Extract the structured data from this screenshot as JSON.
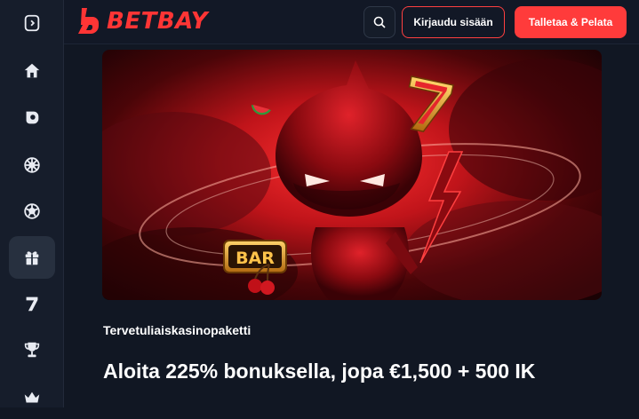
{
  "header": {
    "brand": "BETBAY",
    "login_label": "Kirjaudu sisään",
    "deposit_label": "Talletaa & Pelata"
  },
  "sidebar": {
    "items": [
      {
        "icon": "collapse-sidebar-icon"
      },
      {
        "icon": "home-icon"
      },
      {
        "icon": "poker-chip-icon"
      },
      {
        "icon": "casino-wheel-icon"
      },
      {
        "icon": "soccer-ball-icon"
      },
      {
        "icon": "gift-icon",
        "active": true
      },
      {
        "icon": "slot-seven-icon"
      },
      {
        "icon": "trophy-icon"
      },
      {
        "icon": "crown-icon"
      }
    ]
  },
  "promo": {
    "banner_art": {
      "symbols": [
        "BAR",
        "7"
      ]
    },
    "subtitle": "Tervetuliaiskasinopaketti",
    "headline": "Aloita 225% bonuksella, jopa €1,500 + 500 IK"
  },
  "colors": {
    "accent": "#ff3b3b",
    "background": "#111723",
    "sidebar": "#161d2b"
  }
}
